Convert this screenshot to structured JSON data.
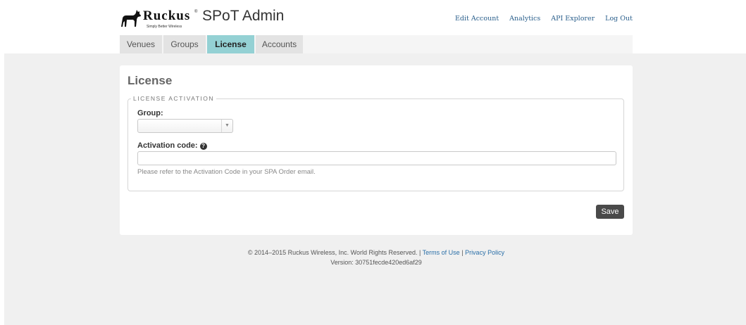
{
  "brand": {
    "logo_word": "Ruckus",
    "logo_tagline": "Simply Better Wireless",
    "logo_reg": "®",
    "app_title": "SPoT Admin"
  },
  "top_links": [
    "Edit Account",
    "Analytics",
    "API Explorer",
    "Log Out"
  ],
  "tabs": [
    "Venues",
    "Groups",
    "License",
    "Accounts"
  ],
  "active_tab": "License",
  "page": {
    "title": "License",
    "fieldset_legend": "LICENSE ACTIVATION",
    "group_label": "Group:",
    "group_value": "",
    "activation_label": "Activation code:",
    "help_glyph": "?",
    "activation_value": "",
    "activation_hint": "Please refer to the Activation Code in your SPA Order email.",
    "save_label": "Save"
  },
  "footer": {
    "copyright": "© 2014–2015 Ruckus Wireless, Inc. World Rights Reserved. |",
    "terms_link": "Terms of Use",
    "separator": "|",
    "privacy_link": "Privacy Policy",
    "version": "Version: 30751fecde420ed6af29"
  },
  "colors": {
    "active_tab": "#94d1d4",
    "link": "#2a5f8c",
    "save_button": "#4a4a4a",
    "page_background": "#f0f0f0"
  },
  "icons": {
    "logo": "ruckus-dog-icon",
    "select_arrow": "chevron-down-icon",
    "help": "question-circle-icon"
  }
}
